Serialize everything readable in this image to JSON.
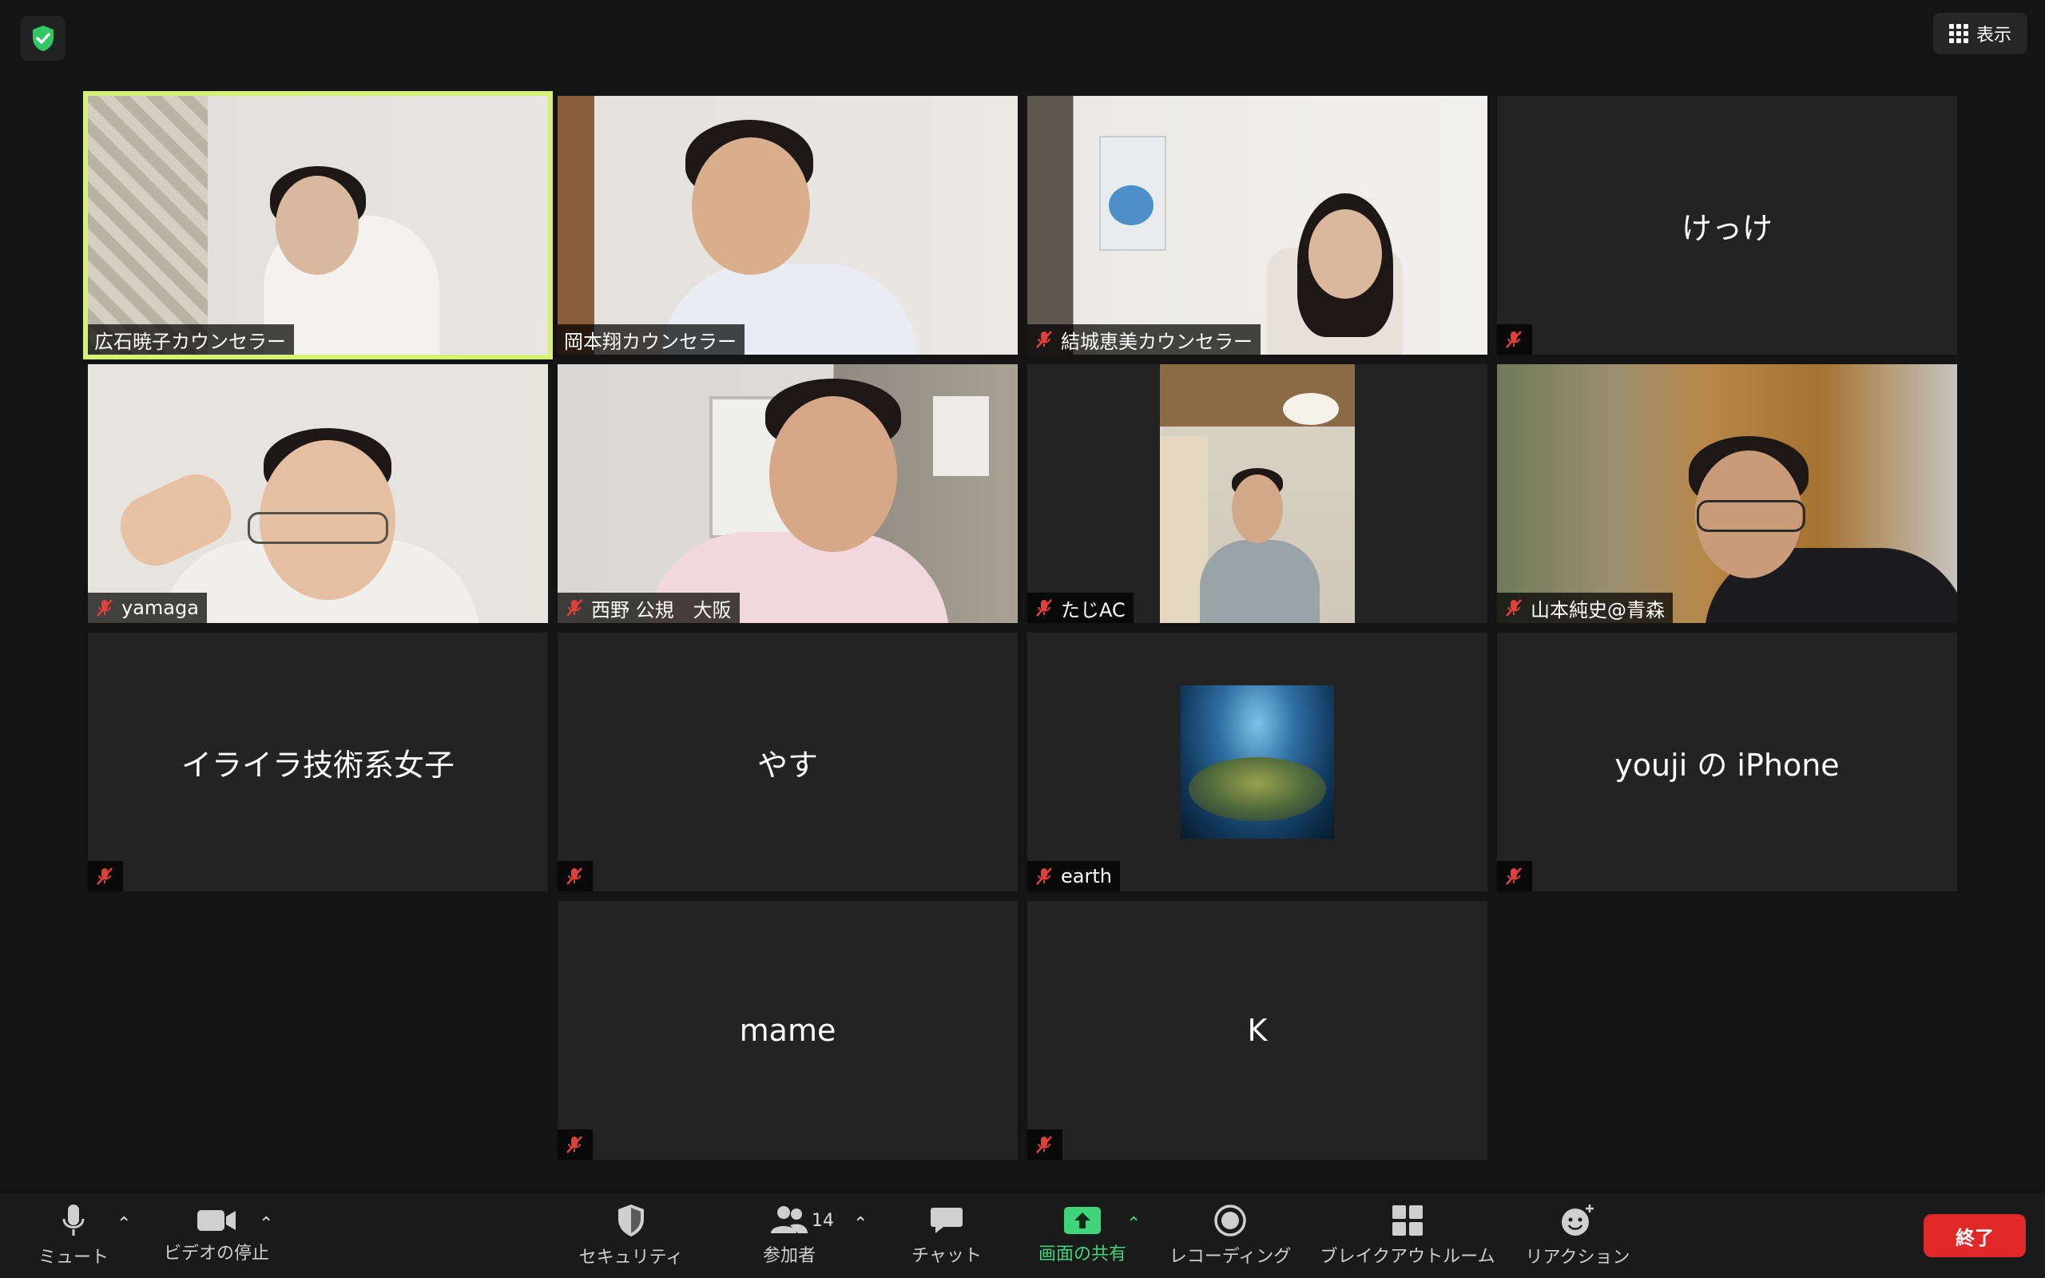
{
  "header": {
    "view_label": "表示"
  },
  "participants": [
    {
      "name": "広石暁子カウンセラー",
      "muted": false,
      "video": true
    },
    {
      "name": "岡本翔カウンセラー",
      "muted": false,
      "video": true
    },
    {
      "name": "結城恵美カウンセラー",
      "muted": true,
      "video": true
    },
    {
      "name": "けっけ",
      "muted": true,
      "video": false
    },
    {
      "name": "yamaga",
      "muted": true,
      "video": true
    },
    {
      "name": "西野 公規　大阪",
      "muted": true,
      "video": true
    },
    {
      "name": "たじAC",
      "muted": true,
      "video": true
    },
    {
      "name": "山本純史@青森",
      "muted": true,
      "video": true
    },
    {
      "name": "イライラ技術系女子",
      "muted": true,
      "video": false
    },
    {
      "name": "やす",
      "muted": true,
      "video": false
    },
    {
      "name": "earth",
      "muted": true,
      "video": false
    },
    {
      "name": "youji の iPhone",
      "muted": true,
      "video": false
    },
    {
      "name": "mame",
      "muted": true,
      "video": false
    },
    {
      "name": "K",
      "muted": true,
      "video": false
    }
  ],
  "toolbar": {
    "mute": "ミュート",
    "stop_video": "ビデオの停止",
    "security": "セキュリティ",
    "participants": "参加者",
    "participant_count": "14",
    "chat": "チャット",
    "share_screen": "画面の共有",
    "recording": "レコーディング",
    "breakout": "ブレイクアウトルーム",
    "reactions": "リアクション",
    "end": "終了"
  },
  "colors": {
    "active_speaker": "#d7f07a",
    "share_green": "#3fd57a",
    "end_red": "#e02828",
    "mute_red": "#e0403a"
  }
}
